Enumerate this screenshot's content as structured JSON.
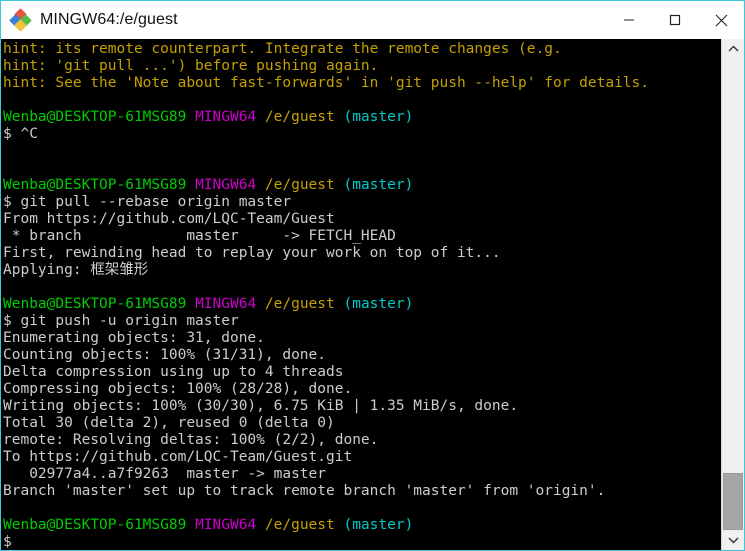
{
  "window": {
    "title": "MINGW64:/e/guest",
    "icon": "git-bash-icon",
    "border_color": "#3bc9db",
    "controls": [
      {
        "name": "minimize-button",
        "label": "─",
        "title": "Minimize"
      },
      {
        "name": "maximize-button",
        "label": "□",
        "title": "Maximize"
      },
      {
        "name": "close-button",
        "label": "✕",
        "title": "Close"
      }
    ]
  },
  "terminal": {
    "background": "#000000",
    "foreground": "#cccccc",
    "colors": {
      "yellow": "#c4a000",
      "green": "#00cc00",
      "magenta": "#cc00cc",
      "cyan": "#00cccc",
      "white": "#cccccc"
    },
    "prompt": {
      "user_host": "Wenba@DESKTOP-61MSG89",
      "shell": "MINGW64",
      "path": "/e/guest",
      "branch": "(master)",
      "symbol": "$"
    },
    "lines": [
      {
        "type": "text",
        "color": "yellow",
        "text": "hint: its remote counterpart. Integrate the remote changes (e.g."
      },
      {
        "type": "text",
        "color": "yellow",
        "text": "hint: 'git pull ...') before pushing again."
      },
      {
        "type": "text",
        "color": "yellow",
        "text": "hint: See the 'Note about fast-forwards' in 'git push --help' for details."
      },
      {
        "type": "blank",
        "color": "white",
        "text": ""
      },
      {
        "type": "prompt"
      },
      {
        "type": "command",
        "text": "$ ^C"
      },
      {
        "type": "blank",
        "color": "white",
        "text": ""
      },
      {
        "type": "blank",
        "color": "white",
        "text": ""
      },
      {
        "type": "prompt"
      },
      {
        "type": "command",
        "text": "$ git pull --rebase origin master"
      },
      {
        "type": "text",
        "color": "white",
        "text": "From https://github.com/LQC-Team/Guest"
      },
      {
        "type": "text",
        "color": "white",
        "text": " * branch            master     -> FETCH_HEAD"
      },
      {
        "type": "text",
        "color": "white",
        "text": "First, rewinding head to replay your work on top of it..."
      },
      {
        "type": "text",
        "color": "white",
        "text": "Applying: 框架雏形"
      },
      {
        "type": "blank",
        "color": "white",
        "text": ""
      },
      {
        "type": "prompt"
      },
      {
        "type": "command",
        "text": "$ git push -u origin master"
      },
      {
        "type": "text",
        "color": "white",
        "text": "Enumerating objects: 31, done."
      },
      {
        "type": "text",
        "color": "white",
        "text": "Counting objects: 100% (31/31), done."
      },
      {
        "type": "text",
        "color": "white",
        "text": "Delta compression using up to 4 threads"
      },
      {
        "type": "text",
        "color": "white",
        "text": "Compressing objects: 100% (28/28), done."
      },
      {
        "type": "text",
        "color": "white",
        "text": "Writing objects: 100% (30/30), 6.75 KiB | 1.35 MiB/s, done."
      },
      {
        "type": "text",
        "color": "white",
        "text": "Total 30 (delta 2), reused 0 (delta 0)"
      },
      {
        "type": "text",
        "color": "white",
        "text": "remote: Resolving deltas: 100% (2/2), done."
      },
      {
        "type": "text",
        "color": "white",
        "text": "To https://github.com/LQC-Team/Guest.git"
      },
      {
        "type": "text",
        "color": "white",
        "text": "   02977a4..a7f9263  master -> master"
      },
      {
        "type": "text",
        "color": "white",
        "text": "Branch 'master' set up to track remote branch 'master' from 'origin'."
      },
      {
        "type": "blank",
        "color": "white",
        "text": ""
      },
      {
        "type": "prompt"
      },
      {
        "type": "command",
        "text": "$"
      }
    ]
  },
  "scrollbar": {
    "up_arrow": "⌃",
    "down_arrow": "⌄",
    "thumb_top_pct": 88,
    "thumb_height_pct": 12
  }
}
